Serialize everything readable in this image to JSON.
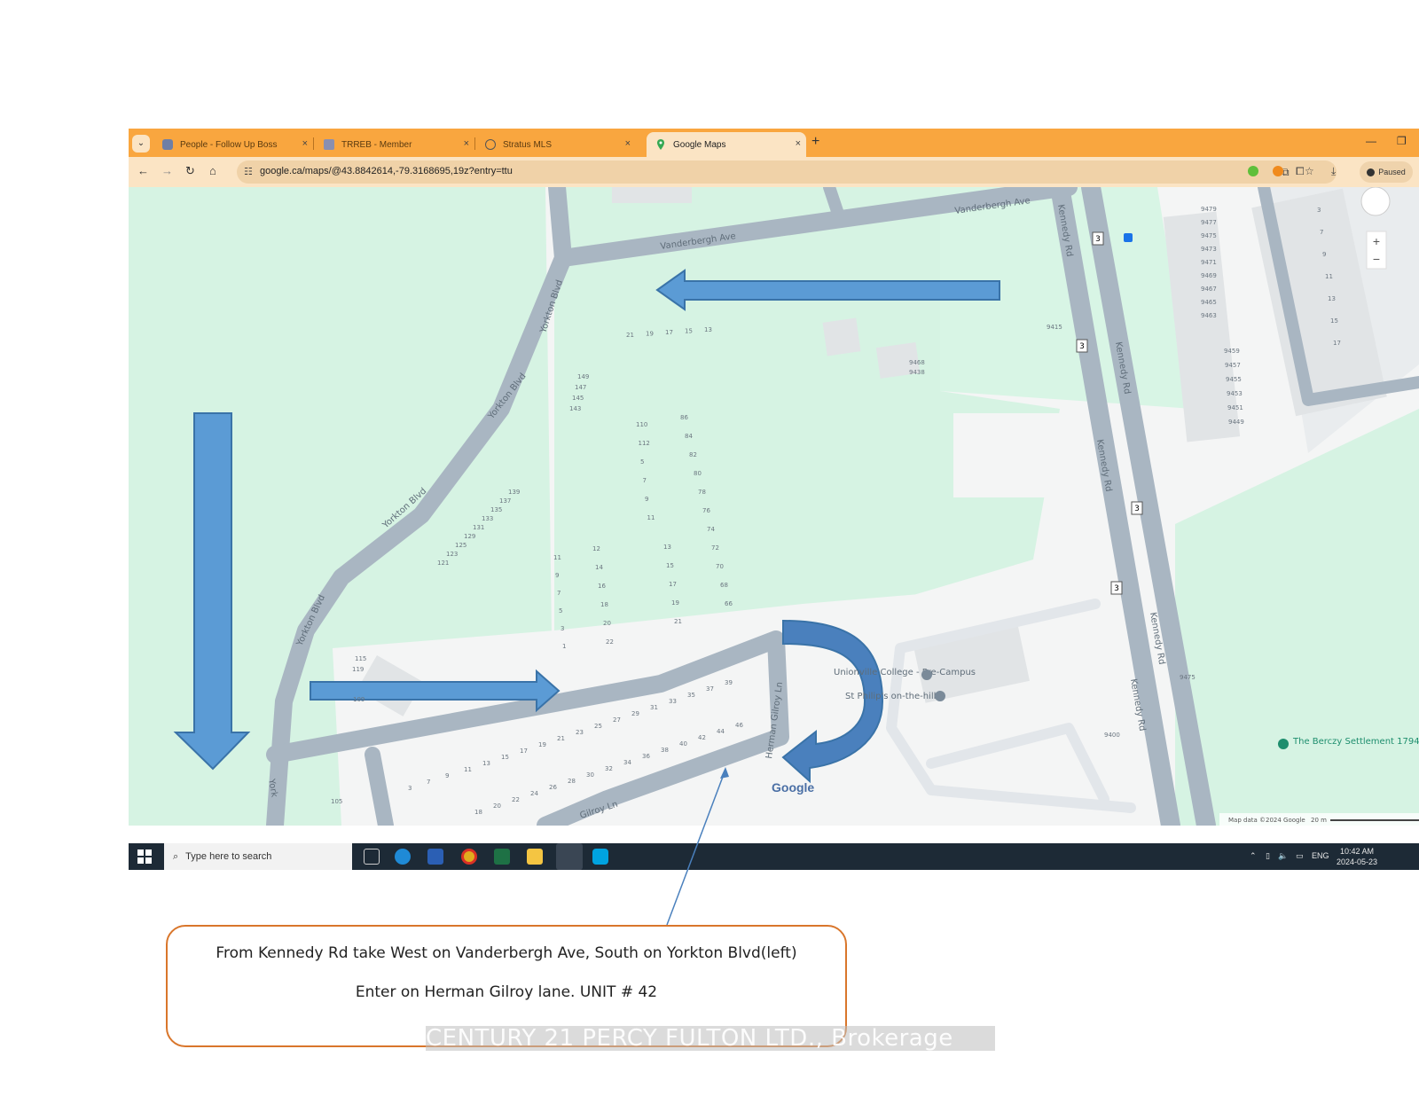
{
  "browser": {
    "tabs": [
      {
        "label": "People - Follow Up Boss",
        "active": false
      },
      {
        "label": "TRREB - Member",
        "active": false
      },
      {
        "label": "Stratus MLS",
        "active": false
      },
      {
        "label": "Google Maps",
        "active": true
      }
    ],
    "new_tab": "+",
    "url": "google.ca/maps/@43.8842614,-79.3168695,19z?entry=ttu",
    "profile_label": "Paused",
    "tab_close": "×"
  },
  "map": {
    "streets": {
      "vanderbergh_1": "Vanderbergh Ave",
      "vanderbergh_2": "Vanderbergh Ave",
      "yorkton_1": "Yorkton Blvd",
      "yorkton_2": "Yorkton Blvd",
      "yorkton_3": "Yorkton Blvd",
      "yorkton_4": "Yorkton Blvd",
      "yorkton_5": "York",
      "kennedy_1": "Kennedy Rd",
      "kennedy_2": "Kennedy Rd",
      "kennedy_3": "Kennedy Rd",
      "kennedy_4": "Kennedy Rd",
      "kennedy_5": "Kennedy Rd",
      "herman_gilroy": "Herman Gilroy Ln",
      "gilroy": "Gilroy Ln"
    },
    "route_shield": "3",
    "places": {
      "college": "Unionville College - Pre-Campus",
      "church": "St Philip's on-the-hill",
      "berczy": "The Berczy Settlement 1794"
    },
    "logo": "Google",
    "attribution": "Map data ©2024 Google",
    "scale": "20 m",
    "address_numbers_top": [
      "21",
      "19",
      "17",
      "15",
      "13"
    ],
    "address_numbers_col1": [
      "149",
      "147",
      "145",
      "143"
    ],
    "address_numbers_col2": [
      "110",
      "112",
      "5",
      "7",
      "9",
      "11"
    ],
    "address_numbers_col3": [
      "86",
      "84",
      "82",
      "80",
      "78",
      "76",
      "74",
      "72",
      "70",
      "68",
      "66"
    ],
    "address_numbers_col4": [
      "139",
      "137",
      "135",
      "133",
      "131",
      "129",
      "125",
      "123",
      "121"
    ],
    "address_numbers_col5": [
      "11",
      "9",
      "7",
      "5",
      "3",
      "1"
    ],
    "address_numbers_col6": [
      "12",
      "14",
      "16",
      "18",
      "20",
      "22"
    ],
    "address_numbers_col7": [
      "13",
      "15",
      "17",
      "19",
      "21"
    ],
    "address_numbers_row_upper": [
      "3",
      "7",
      "9",
      "11",
      "13",
      "15",
      "17",
      "19",
      "21",
      "23",
      "25",
      "27",
      "29",
      "31",
      "33",
      "35",
      "37",
      "39"
    ],
    "address_numbers_row_lower": [
      "18",
      "20",
      "22",
      "24",
      "26",
      "28",
      "30",
      "32",
      "34",
      "36",
      "38",
      "40",
      "42",
      "44",
      "46"
    ],
    "right_numbers_a": [
      "9479",
      "9477",
      "9475",
      "9473",
      "9471",
      "9469",
      "9467",
      "9465",
      "9463"
    ],
    "right_numbers_b": [
      "9459",
      "9457",
      "9455",
      "9453",
      "9451",
      "9449"
    ],
    "right_numbers_c": [
      "3",
      "7",
      "9",
      "11",
      "13",
      "15",
      "17"
    ],
    "misc_numbers": [
      "9468",
      "9438",
      "9415",
      "9475",
      "9400",
      "115",
      "119",
      "109",
      "105"
    ]
  },
  "taskbar": {
    "search_placeholder": "Type here to search",
    "lang": "ENG",
    "time": "10:42 AM",
    "date": "2024-05-23"
  },
  "annotation": {
    "line1": "From Kennedy Rd take West on Vanderbergh Ave, South on Yorkton Blvd(left)",
    "line2": "Enter on Herman Gilroy lane. UNIT # 42"
  },
  "watermark": "CENTURY 21 PERCY FULTON LTD., Brokerage",
  "colors": {
    "tabbar": "#f9a63f",
    "toolbar": "#fbe4c4",
    "park": "#d9f6e6",
    "road": "#a9b6c2",
    "arrow": "#5b9bd5",
    "callout_border": "#d9762b"
  }
}
